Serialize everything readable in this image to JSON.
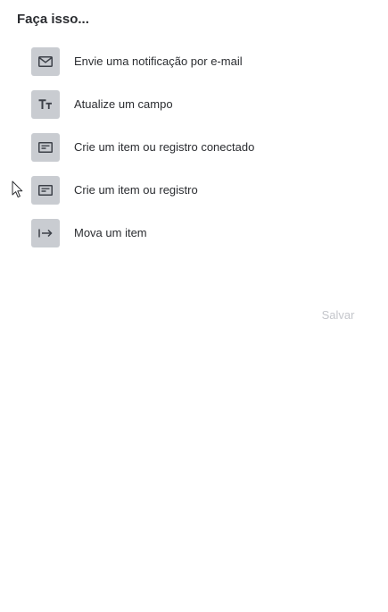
{
  "heading": "Faça isso...",
  "actions": [
    {
      "label": "Envie uma notificação por e-mail",
      "icon": "envelope-icon"
    },
    {
      "label": "Atualize um campo",
      "icon": "text-field-icon"
    },
    {
      "label": "Crie um item ou registro conectado",
      "icon": "record-card-icon"
    },
    {
      "label": "Crie um item ou registro",
      "icon": "record-card-icon"
    },
    {
      "label": "Mova um item",
      "icon": "move-arrow-icon"
    }
  ],
  "footer": {
    "save_label": "Salvar"
  },
  "colors": {
    "icon_tile": "#c9ccd1",
    "icon_stroke": "#3c4048",
    "text": "#2b2d31",
    "save_disabled": "#c4c6cb"
  }
}
